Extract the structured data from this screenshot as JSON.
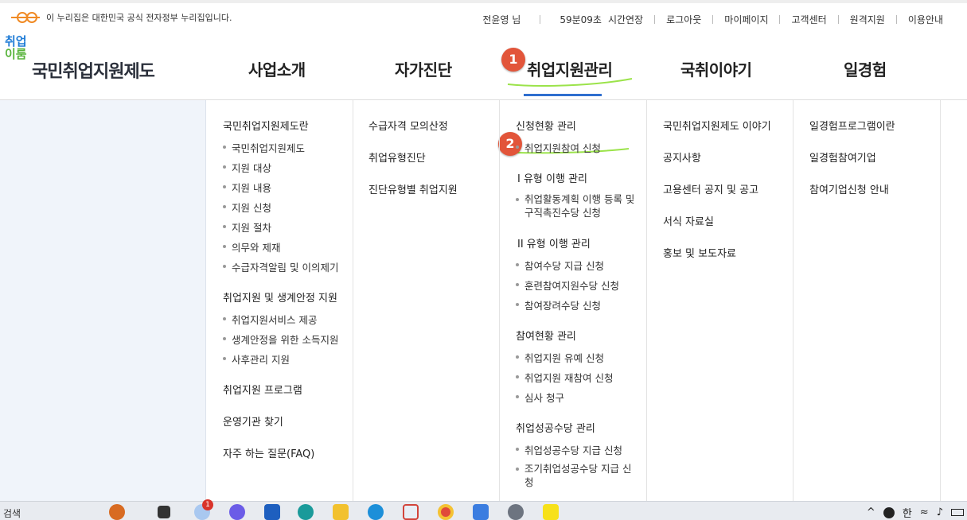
{
  "top": {
    "gov_notice": "이 누리집은 대한민국 공식 전자정부 누리집입니다.",
    "user": "전윤영 님",
    "timer": "59분09초",
    "extend": "시간연장",
    "links": [
      "로그아웃",
      "마이페이지",
      "고객센터",
      "원격지원",
      "이용안내"
    ]
  },
  "logo": {
    "mark_top": "취업",
    "mark_bottom": "이룸",
    "name": "국민취업지원제도"
  },
  "nav": [
    "사업소개",
    "자가진단",
    "취업지원관리",
    "국취이야기",
    "일경험"
  ],
  "badges": [
    "1",
    "2"
  ],
  "menu": {
    "col1": {
      "h1": "국민취업지원제도란",
      "s1": [
        "국민취업지원제도",
        "지원 대상",
        "지원 내용",
        "지원 신청",
        "지원 절차",
        "의무와 제재",
        "수급자격알림 및 이의제기"
      ],
      "h2": "취업지원 및 생계안정 지원",
      "s2": [
        "취업지원서비스 제공",
        "생계안정을 위한 소득지원",
        "사후관리 지원"
      ],
      "h3": "취업지원 프로그램",
      "h4": "운영기관 찾기",
      "h5": "자주 하는 질문(FAQ)"
    },
    "col2": [
      "수급자격 모의산정",
      "취업유형진단",
      "진단유형별 취업지원"
    ],
    "col3": {
      "h1": "신청현황 관리",
      "s1": "취업지원참여 신청",
      "h2": "I 유형 이행 관리",
      "s2": "취업활동계획 이행 등록 및 구직촉진수당 신청",
      "h3": "II 유형 이행 관리",
      "s3": [
        "참여수당 지급 신청",
        "훈련참여지원수당 신청",
        "참여장려수당 신청"
      ],
      "h4": "참여현황 관리",
      "s4": [
        "취업지원 유예 신청",
        "취업지원 재참여 신청",
        "심사 청구"
      ],
      "h5": "취업성공수당 관리",
      "s5": [
        "취업성공수당 지급 신청",
        "조기취업성공수당 지급 신청"
      ]
    },
    "col4": [
      "국민취업지원제도 이야기",
      "공지사항",
      "고용센터 공지 및 공고",
      "서식 자료실",
      "홍보 및 보도자료"
    ],
    "col5": [
      "일경험프로그램이란",
      "일경험참여기업",
      "참여기업신청 안내"
    ]
  },
  "taskbar": {
    "search": "검색",
    "notification_count": "1",
    "ime": "한",
    "icons": [
      "weather-icon",
      "task-view-icon",
      "chat-icon",
      "store-icon",
      "copilot-icon",
      "folder-icon",
      "edge-icon",
      "snip-icon",
      "chrome-icon",
      "notepad-icon",
      "settings-icon",
      "kakaotalk-icon"
    ]
  },
  "colors": {
    "nav_active": "#2f6fcf",
    "badge": "#e2553a",
    "highlight": "#9be34a",
    "left_pane": "#f0f4fa"
  }
}
